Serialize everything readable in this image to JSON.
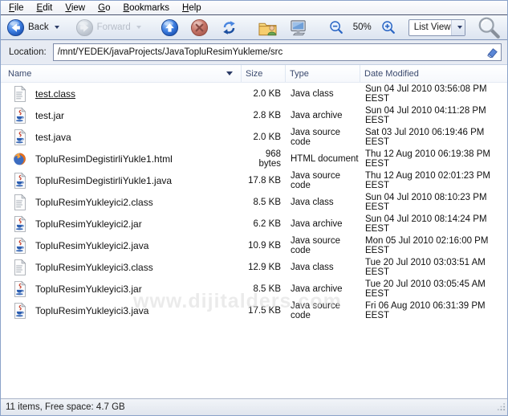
{
  "menu": {
    "items": [
      {
        "label": "File",
        "accel_index": 0
      },
      {
        "label": "Edit",
        "accel_index": 0
      },
      {
        "label": "View",
        "accel_index": 0
      },
      {
        "label": "Go",
        "accel_index": 0
      },
      {
        "label": "Bookmarks",
        "accel_index": 0
      },
      {
        "label": "Help",
        "accel_index": 0
      }
    ]
  },
  "toolbar": {
    "back_label": "Back",
    "forward_label": "Forward",
    "zoom_level": "50%",
    "view_mode": "List View"
  },
  "icons": {
    "back-icon": "blue circle left arrow",
    "forward-icon": "gray disabled circle right arrow",
    "up-icon": "blue circle up arrow",
    "stop-icon": "red circle X (disabled)",
    "refresh-icon": "two blue curved arrows",
    "home-folder-icon": "yellow folder with person",
    "computer-icon": "desktop monitor",
    "zoom-out-icon": "magnifier with minus",
    "zoom-in-icon": "magnifier with plus",
    "search-icon": "large gray magnifier",
    "clear-location-icon": "small eraser",
    "sort-desc-icon": "down triangle",
    "java-class-icon": "document page with binary content",
    "java-icon": "document page with java coffee cup",
    "firefox-icon": "firefox globe",
    "resize-grip-icon": "diagonal dots"
  },
  "location": {
    "label": "Location:",
    "value": "/mnt/YEDEK/javaProjects/JavaTopluResimYukleme/src"
  },
  "list": {
    "columns": [
      "Name",
      "Size",
      "Type",
      "Date Modified"
    ],
    "rows": [
      {
        "icon": "java-class-icon",
        "name": "test.class",
        "hovered": true,
        "size": "2.0 KB",
        "type": "Java class",
        "modified": "Sun 04 Jul 2010 03:56:08 PM EEST"
      },
      {
        "icon": "java-icon",
        "name": "test.jar",
        "hovered": false,
        "size": "2.8 KB",
        "type": "Java archive",
        "modified": "Sun 04 Jul 2010 04:11:28 PM EEST"
      },
      {
        "icon": "java-icon",
        "name": "test.java",
        "hovered": false,
        "size": "2.0 KB",
        "type": "Java source code",
        "modified": "Sat 03 Jul 2010 06:19:46 PM EEST"
      },
      {
        "icon": "firefox-icon",
        "name": "TopluResimDegistirliYukle1.html",
        "hovered": false,
        "size": "968 bytes",
        "type": "HTML document",
        "modified": "Thu 12 Aug 2010 06:19:38 PM EEST"
      },
      {
        "icon": "java-icon",
        "name": "TopluResimDegistirliYukle1.java",
        "hovered": false,
        "size": "17.8 KB",
        "type": "Java source code",
        "modified": "Thu 12 Aug 2010 02:01:23 PM EEST"
      },
      {
        "icon": "java-class-icon",
        "name": "TopluResimYukleyici2.class",
        "hovered": false,
        "size": "8.5 KB",
        "type": "Java class",
        "modified": "Sun 04 Jul 2010 08:10:23 PM EEST"
      },
      {
        "icon": "java-icon",
        "name": "TopluResimYukleyici2.jar",
        "hovered": false,
        "size": "6.2 KB",
        "type": "Java archive",
        "modified": "Sun 04 Jul 2010 08:14:24 PM EEST"
      },
      {
        "icon": "java-icon",
        "name": "TopluResimYukleyici2.java",
        "hovered": false,
        "size": "10.9 KB",
        "type": "Java source code",
        "modified": "Mon 05 Jul 2010 02:16:00 PM EEST"
      },
      {
        "icon": "java-class-icon",
        "name": "TopluResimYukleyici3.class",
        "hovered": false,
        "size": "12.9 KB",
        "type": "Java class",
        "modified": "Tue 20 Jul 2010 03:03:51 AM EEST"
      },
      {
        "icon": "java-icon",
        "name": "TopluResimYukleyici3.jar",
        "hovered": false,
        "size": "8.5 KB",
        "type": "Java archive",
        "modified": "Tue 20 Jul 2010 03:05:45 AM EEST"
      },
      {
        "icon": "java-icon",
        "name": "TopluResimYukleyici3.java",
        "hovered": false,
        "size": "17.5 KB",
        "type": "Java source code",
        "modified": "Fri 06 Aug 2010 06:31:39 PM EEST"
      }
    ]
  },
  "watermark": {
    "text": "www.dijitalders.com"
  },
  "status": {
    "text": "11 items, Free space: 4.7 GB"
  },
  "colors": {
    "accent_blue": "#2a66c8",
    "header_text": "#3b4a6e",
    "toolbar_top": "#f6f9fc",
    "toolbar_bottom": "#dce4f0",
    "location_bg": "#e7ebf3",
    "status_bg": "#e8ecf3"
  }
}
